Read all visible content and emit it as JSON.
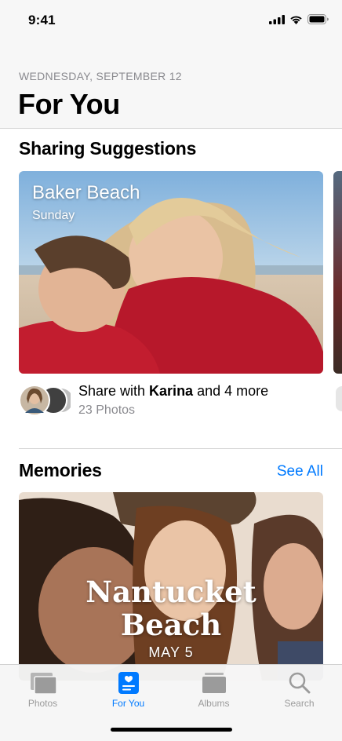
{
  "status_bar": {
    "time": "9:41"
  },
  "header": {
    "date": "WEDNESDAY, SEPTEMBER 12",
    "title": "For You"
  },
  "sharing": {
    "section_title": "Sharing Suggestions",
    "card": {
      "title": "Baker Beach",
      "subtitle": "Sunday"
    },
    "share_prefix": "Share with ",
    "share_name": "Karina",
    "share_suffix": " and 4 more",
    "photo_count": "23 Photos"
  },
  "memories": {
    "section_title": "Memories",
    "see_all": "See All",
    "card": {
      "title_line1": "Nantucket",
      "title_line2": "Beach",
      "date": "MAY 5"
    }
  },
  "tabs": [
    {
      "label": "Photos",
      "icon": "photos-icon",
      "active": false
    },
    {
      "label": "For You",
      "icon": "for-you-icon",
      "active": true
    },
    {
      "label": "Albums",
      "icon": "albums-icon",
      "active": false
    },
    {
      "label": "Search",
      "icon": "search-icon",
      "active": false
    }
  ],
  "colors": {
    "accent": "#007aff",
    "inactive_tab": "#9b9b9b",
    "secondary_text": "#8a8a8f"
  }
}
